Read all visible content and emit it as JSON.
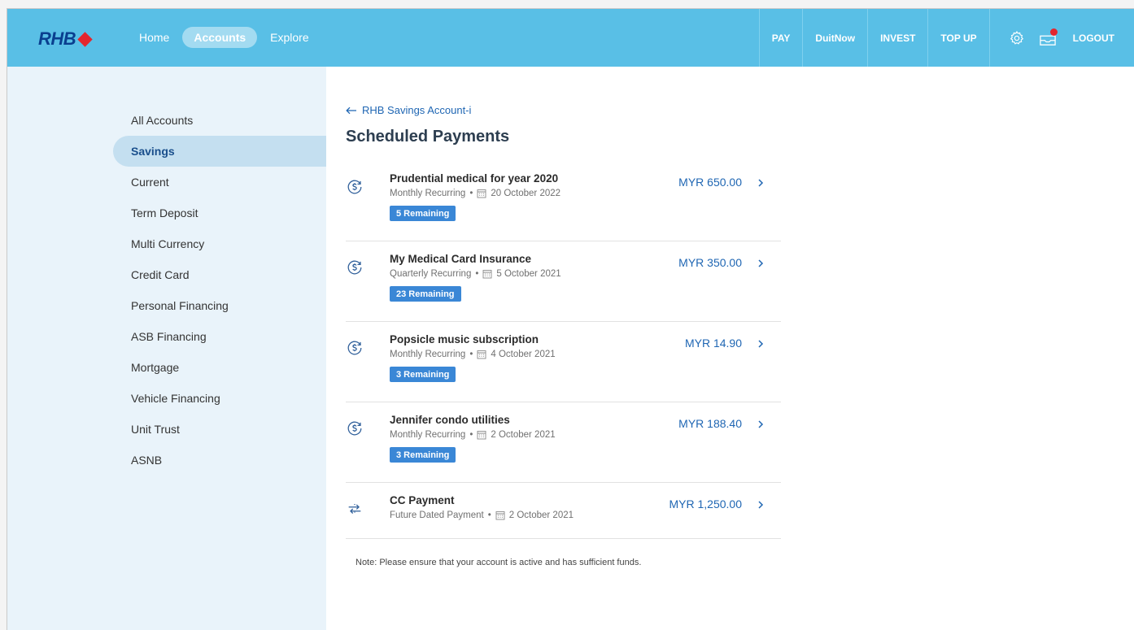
{
  "brand": {
    "name": "RHB"
  },
  "nav": {
    "links": [
      {
        "label": "Home",
        "active": false
      },
      {
        "label": "Accounts",
        "active": true
      },
      {
        "label": "Explore",
        "active": false
      }
    ],
    "actions": [
      "PAY",
      "DuitNow",
      "INVEST",
      "TOP UP"
    ],
    "logout": "LOGOUT"
  },
  "colors": {
    "topbar": "#59bfe6",
    "accent": "#1f66b3",
    "badge": "#3a87d6",
    "sidebar": "#e9f3fa"
  },
  "sidebar": {
    "items": [
      {
        "label": "All Accounts",
        "active": false
      },
      {
        "label": "Savings",
        "active": true
      },
      {
        "label": "Current",
        "active": false
      },
      {
        "label": "Term Deposit",
        "active": false
      },
      {
        "label": "Multi Currency",
        "active": false
      },
      {
        "label": "Credit Card",
        "active": false
      },
      {
        "label": "Personal Financing",
        "active": false
      },
      {
        "label": "ASB Financing",
        "active": false
      },
      {
        "label": "Mortgage",
        "active": false
      },
      {
        "label": "Vehicle Financing",
        "active": false
      },
      {
        "label": "Unit Trust",
        "active": false
      },
      {
        "label": "ASNB",
        "active": false
      }
    ]
  },
  "main": {
    "back_label": "RHB Savings Account-i",
    "title": "Scheduled Payments",
    "payments": [
      {
        "title": "Prudential medical for year 2020",
        "frequency": "Monthly Recurring",
        "date": "20 October 2022",
        "amount": "MYR 650.00",
        "remaining": "5 Remaining",
        "icon": "recurring-dollar-icon"
      },
      {
        "title": "My Medical Card Insurance",
        "frequency": "Quarterly Recurring",
        "date": "5 October 2021",
        "amount": "MYR 350.00",
        "remaining": "23 Remaining",
        "icon": "recurring-dollar-icon"
      },
      {
        "title": "Popsicle music subscription",
        "frequency": "Monthly Recurring",
        "date": "4 October 2021",
        "amount": "MYR 14.90",
        "remaining": "3 Remaining",
        "icon": "recurring-dollar-icon"
      },
      {
        "title": "Jennifer condo utilities",
        "frequency": "Monthly Recurring",
        "date": "2 October 2021",
        "amount": "MYR 188.40",
        "remaining": "3 Remaining",
        "icon": "recurring-dollar-icon"
      },
      {
        "title": "CC Payment",
        "frequency": "Future Dated Payment",
        "date": "2 October 2021",
        "amount": "MYR 1,250.00",
        "remaining": "",
        "icon": "transfer-icon"
      }
    ],
    "note": "Note: Please ensure that your account is active and has sufficient funds."
  }
}
